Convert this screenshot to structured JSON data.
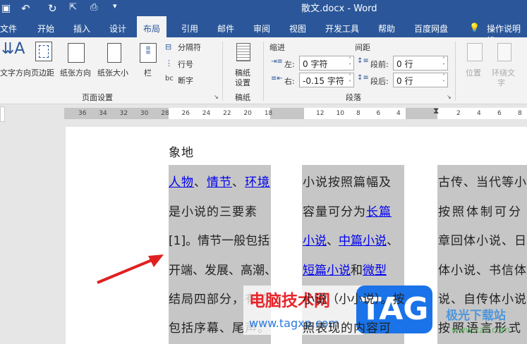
{
  "title": "散文.docx  -  Word",
  "tabs": [
    "文件",
    "开始",
    "插入",
    "设计",
    "布局",
    "引用",
    "邮件",
    "审阅",
    "视图",
    "开发工具",
    "帮助",
    "百度网盘"
  ],
  "active_tab": "布局",
  "tell_me": "操作说明搜",
  "ribbon": {
    "page_setup": {
      "text_direction": "文字方向",
      "margins": "页边距",
      "orientation": "纸张方向",
      "size": "纸张大小",
      "columns": "栏",
      "breaks": "分隔符",
      "line_numbers": "行号",
      "hyphenation": "断字",
      "group": "页面设置"
    },
    "manuscript": {
      "setup": "稿纸\n设置",
      "setup_l1": "稿纸",
      "setup_l2": "设置",
      "group": "稿纸"
    },
    "paragraph": {
      "indent": "缩进",
      "spacing": "间距",
      "left_label": "左:",
      "left_value": "0 字符",
      "right_label": "右:",
      "right_value": "-0.15 字符",
      "before_label": "段前:",
      "before_value": "0 行",
      "after_label": "段后:",
      "after_value": "0 行",
      "group": "段落"
    },
    "arrange": {
      "position": "位置",
      "wrap_l1": "环绕文",
      "wrap_l2": "字"
    }
  },
  "ruler": {
    "left": [
      "36",
      "34",
      "32",
      "30",
      "28",
      "26",
      "24",
      "22",
      "20",
      "18"
    ],
    "mid": [
      "12",
      "10",
      "8",
      "6",
      "4"
    ],
    "right": [
      "2",
      "4",
      "6",
      "8"
    ]
  },
  "doc": {
    "top_line": "象地",
    "col1": [
      [
        "人物",
        "link"
      ],
      [
        "、",
        ""
      ],
      [
        "情节",
        "link"
      ],
      [
        "、",
        ""
      ],
      [
        "环境",
        "link"
      ]
    ],
    "col1_lines": [
      "是小说的三要素",
      "[1]。情节一般包括",
      "开端、发展、高潮、",
      "结局四部分，有的",
      "包括序幕、尾声。"
    ],
    "col2_line1": "小说按照篇幅及",
    "col2_line2a": "容量可分为",
    "col2_line2b": "长篇",
    "col2_line3a": "小说",
    "col2_line3b": "、",
    "col2_line3c": "中篇小说",
    "col2_line3d": "、",
    "col2_line4a": "短篇小说",
    "col2_line4b": "和",
    "col2_line4c": "微型",
    "col2_line5": "小说（小小说）。按",
    "col2_line6": "照表现的内容可",
    "col3_lines": [
      "古传、当代等小",
      "按照体制可分",
      "章回体小说、日",
      "体小说、书信体",
      "说、自传体小说",
      "按照语言形式"
    ]
  },
  "watermark": {
    "cn": "电脑技术网",
    "url": "www.tagxp.com",
    "tag": "TAG",
    "site2": "极光下载站",
    "url2": "www.xz7.com"
  },
  "colors": {
    "accent": "#2b579a",
    "link": "#0000ee",
    "arrow": "#e02020"
  }
}
